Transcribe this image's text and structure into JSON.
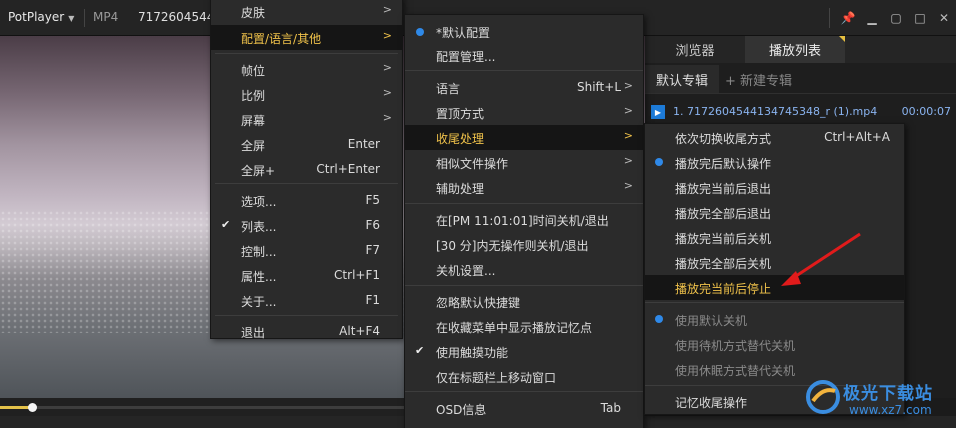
{
  "titlebar": {
    "app_name": "PotPlayer",
    "format": "MP4",
    "file_title": "7172604544"
  },
  "playlist": {
    "tab_browser": "浏览器",
    "tab_playlist": "播放列表",
    "album": "默认专辑",
    "new_album": "+ 新建专辑",
    "file_name": "1. 7172604544134745348_r (1).mp4",
    "file_duration": "00:00:07"
  },
  "menu_main": {
    "items": [
      {
        "label": "皮肤",
        "shortcut": ""
      },
      {
        "label": "配置/语言/其他",
        "shortcut": ""
      },
      {
        "label": "帧位",
        "shortcut": ""
      },
      {
        "label": "比例",
        "shortcut": ""
      },
      {
        "label": "屏幕",
        "shortcut": ""
      },
      {
        "label": "全屏",
        "shortcut": "Enter"
      },
      {
        "label": "全屏+",
        "shortcut": "Ctrl+Enter"
      },
      {
        "label": "选项...",
        "shortcut": "F5"
      },
      {
        "label": "列表...",
        "shortcut": "F6"
      },
      {
        "label": "控制...",
        "shortcut": "F7"
      },
      {
        "label": "属性...",
        "shortcut": "Ctrl+F1"
      },
      {
        "label": "关于...",
        "shortcut": "F1"
      },
      {
        "label": "退出",
        "shortcut": "Alt+F4"
      }
    ]
  },
  "menu_config": {
    "items": [
      {
        "label": "*默认配置",
        "shortcut": ""
      },
      {
        "label": "配置管理...",
        "shortcut": ""
      },
      {
        "label": "语言",
        "shortcut": "Shift+L"
      },
      {
        "label": "置顶方式",
        "shortcut": ""
      },
      {
        "label": "收尾处理",
        "shortcut": ""
      },
      {
        "label": "相似文件操作",
        "shortcut": ""
      },
      {
        "label": "辅助处理",
        "shortcut": ""
      },
      {
        "label": "在[PM 11:01:01]时间关机/退出",
        "shortcut": ""
      },
      {
        "label": "[30 分]内无操作则关机/退出",
        "shortcut": ""
      },
      {
        "label": "关机设置...",
        "shortcut": ""
      },
      {
        "label": "忽略默认快捷键",
        "shortcut": ""
      },
      {
        "label": "在收藏菜单中显示播放记忆点",
        "shortcut": ""
      },
      {
        "label": "使用触摸功能",
        "shortcut": ""
      },
      {
        "label": "仅在标题栏上移动窗口",
        "shortcut": ""
      },
      {
        "label": "OSD信息",
        "shortcut": "Tab"
      }
    ]
  },
  "menu_end": {
    "items": [
      {
        "label": "依次切换收尾方式",
        "shortcut": "Ctrl+Alt+A"
      },
      {
        "label": "播放完后默认操作",
        "shortcut": ""
      },
      {
        "label": "播放完当前后退出",
        "shortcut": ""
      },
      {
        "label": "播放完全部后退出",
        "shortcut": ""
      },
      {
        "label": "播放完当前后关机",
        "shortcut": ""
      },
      {
        "label": "播放完全部后关机",
        "shortcut": ""
      },
      {
        "label": "播放完当前后停止",
        "shortcut": ""
      },
      {
        "label": "使用默认关机",
        "shortcut": ""
      },
      {
        "label": "使用待机方式替代关机",
        "shortcut": ""
      },
      {
        "label": "使用休眠方式替代关机",
        "shortcut": ""
      },
      {
        "label": "记忆收尾操作",
        "shortcut": ""
      }
    ]
  },
  "playback": {
    "progress": 0.05
  },
  "watermark": {
    "name": "极光下载站",
    "url": "www.xz7.com"
  },
  "colors": {
    "accent": "#f0c24a",
    "selection_dot": "#2f89e8",
    "annotation_arrow": "#e11b1b"
  }
}
